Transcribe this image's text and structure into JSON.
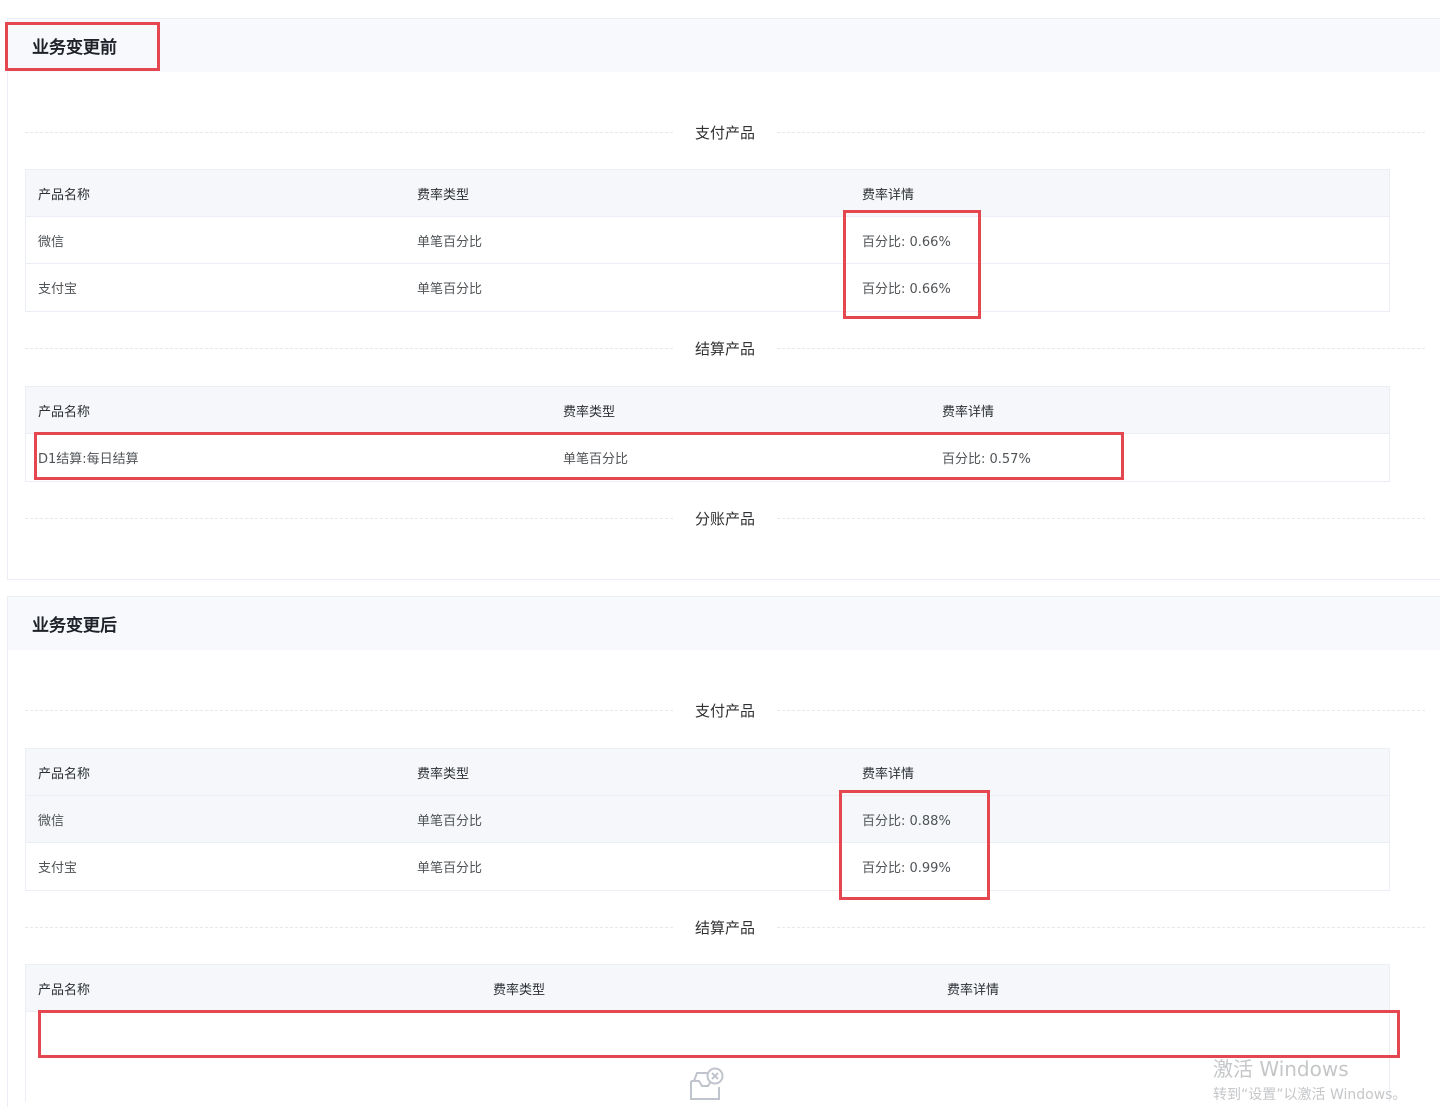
{
  "before": {
    "title": "业务变更前",
    "payment": {
      "section_title": "支付产品",
      "headers": [
        "产品名称",
        "费率类型",
        "费率详情"
      ],
      "rows": [
        [
          "微信",
          "单笔百分比",
          "百分比: 0.66%"
        ],
        [
          "支付宝",
          "单笔百分比",
          "百分比: 0.66%"
        ]
      ]
    },
    "settlement": {
      "section_title": "结算产品",
      "headers": [
        "产品名称",
        "费率类型",
        "费率详情"
      ],
      "rows": [
        [
          "D1结算:每日结算",
          "单笔百分比",
          "百分比: 0.57%"
        ]
      ]
    },
    "split": {
      "section_title": "分账产品"
    }
  },
  "after": {
    "title": "业务变更后",
    "payment": {
      "section_title": "支付产品",
      "headers": [
        "产品名称",
        "费率类型",
        "费率详情"
      ],
      "rows": [
        [
          "微信",
          "单笔百分比",
          "百分比: 0.88%"
        ],
        [
          "支付宝",
          "单笔百分比",
          "百分比: 0.99%"
        ]
      ]
    },
    "settlement": {
      "section_title": "结算产品",
      "headers": [
        "产品名称",
        "费率类型",
        "费率详情"
      ],
      "rows": []
    }
  },
  "watermark": {
    "line1": "激活 Windows",
    "line2": "转到“设置”以激活 Windows。"
  },
  "icons": {
    "empty": "empty-box-icon"
  },
  "colors": {
    "highlight": "#e4474f",
    "header_bg": "#f7f9fc"
  }
}
